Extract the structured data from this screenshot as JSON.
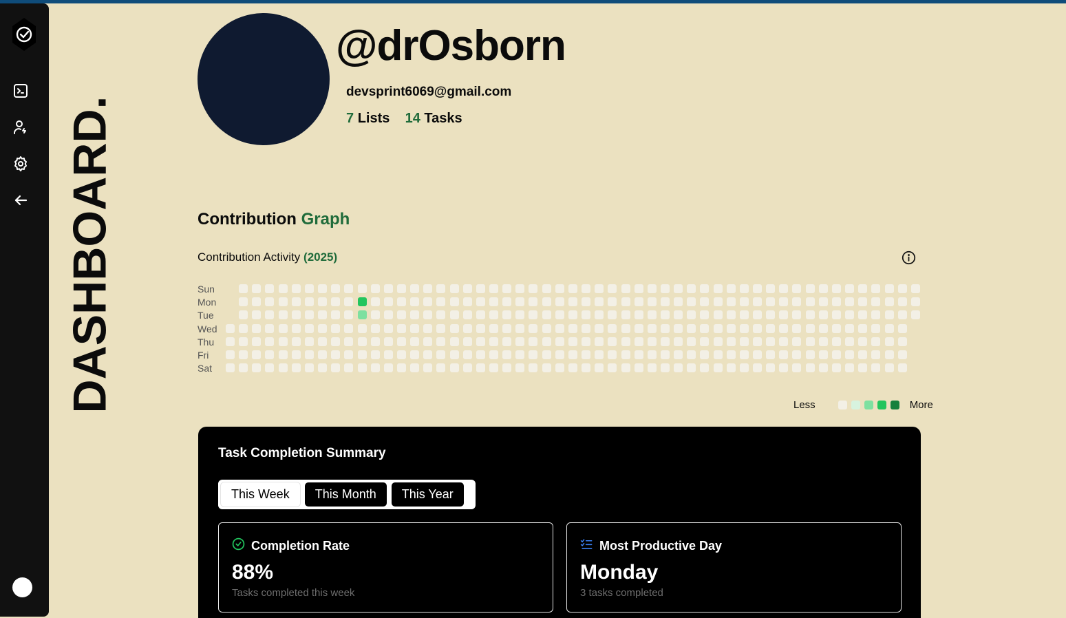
{
  "sidebar": {
    "logo_icon": "check-badge-icon",
    "items": [
      {
        "name": "terminal",
        "icon": "terminal-icon"
      },
      {
        "name": "user-settings",
        "icon": "user-cog-icon"
      },
      {
        "name": "settings",
        "icon": "gear-icon"
      },
      {
        "name": "back",
        "icon": "arrow-left-icon"
      }
    ]
  },
  "page": {
    "vertical_title": "DASHBOARD."
  },
  "profile": {
    "username": "@drOsborn",
    "email": "devsprint6069@gmail.com",
    "lists_count": "7",
    "lists_label": "Lists",
    "tasks_count": "14",
    "tasks_label": "Tasks"
  },
  "contribution": {
    "title_main": "Contribution",
    "title_accent": "Graph",
    "activity_label": "Contribution Activity",
    "year": "(2025)",
    "day_labels": [
      "Sun",
      "Mon",
      "Tue",
      "Wed",
      "Thu",
      "Fri",
      "Sat"
    ],
    "weeks": 53,
    "active_cells": [
      {
        "week": 10,
        "day": 1,
        "level": 3
      },
      {
        "week": 10,
        "day": 2,
        "level": 2
      }
    ],
    "legend_less": "Less",
    "legend_more": "More",
    "level_colors": [
      "#f3f0e6",
      "#d7f3df",
      "#7ee0a0",
      "#22c55e",
      "#15803d"
    ]
  },
  "summary": {
    "title": "Task Completion Summary",
    "tabs": [
      {
        "label": "This Week",
        "active": true
      },
      {
        "label": "This Month",
        "active": false
      },
      {
        "label": "This Year",
        "active": false
      }
    ],
    "cards": [
      {
        "icon": "check-circle-icon",
        "title": "Completion Rate",
        "value": "88%",
        "subtitle": "Tasks completed this week"
      },
      {
        "icon": "list-checks-icon",
        "title": "Most Productive Day",
        "value": "Monday",
        "subtitle": "3 tasks completed"
      }
    ]
  },
  "colors": {
    "background": "#ebe1c0",
    "sidebar": "#111111",
    "accent_green": "#1f6b3a",
    "avatar": "#0f1a30",
    "topbar": "#0f4c7a"
  }
}
